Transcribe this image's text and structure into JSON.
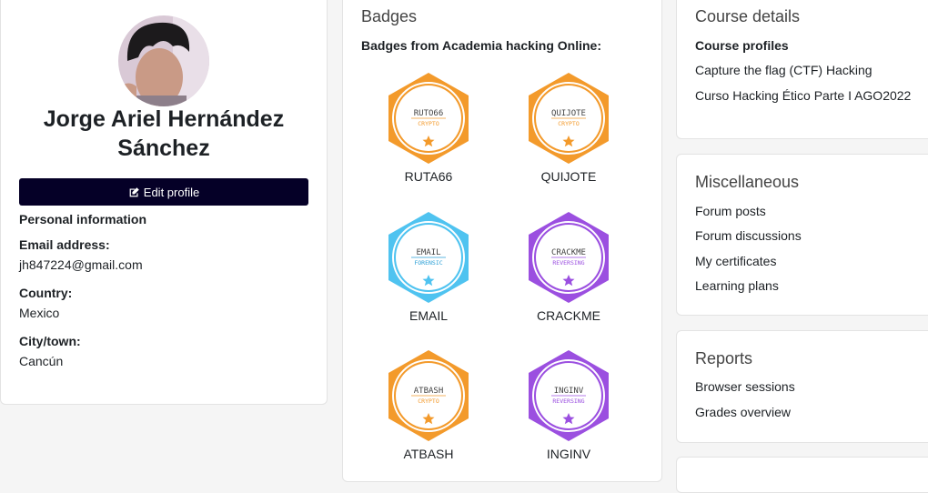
{
  "profile": {
    "name": "Jorge Ariel Hernández Sánchez",
    "edit_label": "Edit profile",
    "personal_info_title": "Personal information",
    "email_label": "Email address:",
    "email": "jh847224@gmail.com",
    "country_label": "Country:",
    "country": "Mexico",
    "city_label": "City/town:",
    "city": "Cancún"
  },
  "badges": {
    "title": "Badges",
    "subtitle": "Badges from Academia hacking Online:",
    "items": [
      {
        "name": "RUTA66",
        "art_text": "RUTO66",
        "art_sub": "CRYPTO",
        "color": "#f39a2b",
        "inner": "#ffffff",
        "sub_color": "#f39a2b"
      },
      {
        "name": "QUIJOTE",
        "art_text": "QUIJOTE",
        "art_sub": "CRYPTO",
        "color": "#f39a2b",
        "inner": "#ffffff",
        "sub_color": "#f39a2b"
      },
      {
        "name": "EMAIL",
        "art_text": "EMAIL",
        "art_sub": "FORENSIC",
        "color": "#4fc3f0",
        "inner": "#ffffff",
        "sub_color": "#2a9fd6"
      },
      {
        "name": "CRACKME",
        "art_text": "CRACKME",
        "art_sub": "REVERSING",
        "color": "#9b4fe0",
        "inner": "#ffffff",
        "sub_color": "#9b4fe0"
      },
      {
        "name": "ATBASH",
        "art_text": "ATBASH",
        "art_sub": "CRYPTO",
        "color": "#f39a2b",
        "inner": "#ffffff",
        "sub_color": "#f39a2b"
      },
      {
        "name": "INGINV",
        "art_text": "INGINV",
        "art_sub": "REVERSING",
        "color": "#9b4fe0",
        "inner": "#ffffff",
        "sub_color": "#9b4fe0"
      }
    ]
  },
  "course_details": {
    "title": "Course details",
    "subtitle": "Course profiles",
    "links": [
      "Capture the flag (CTF) Hacking",
      "Curso Hacking Ético Parte I AGO2022"
    ]
  },
  "misc": {
    "title": "Miscellaneous",
    "links": [
      "Forum posts",
      "Forum discussions",
      "My certificates",
      "Learning plans"
    ]
  },
  "reports": {
    "title": "Reports",
    "links": [
      "Browser sessions",
      "Grades overview"
    ]
  }
}
